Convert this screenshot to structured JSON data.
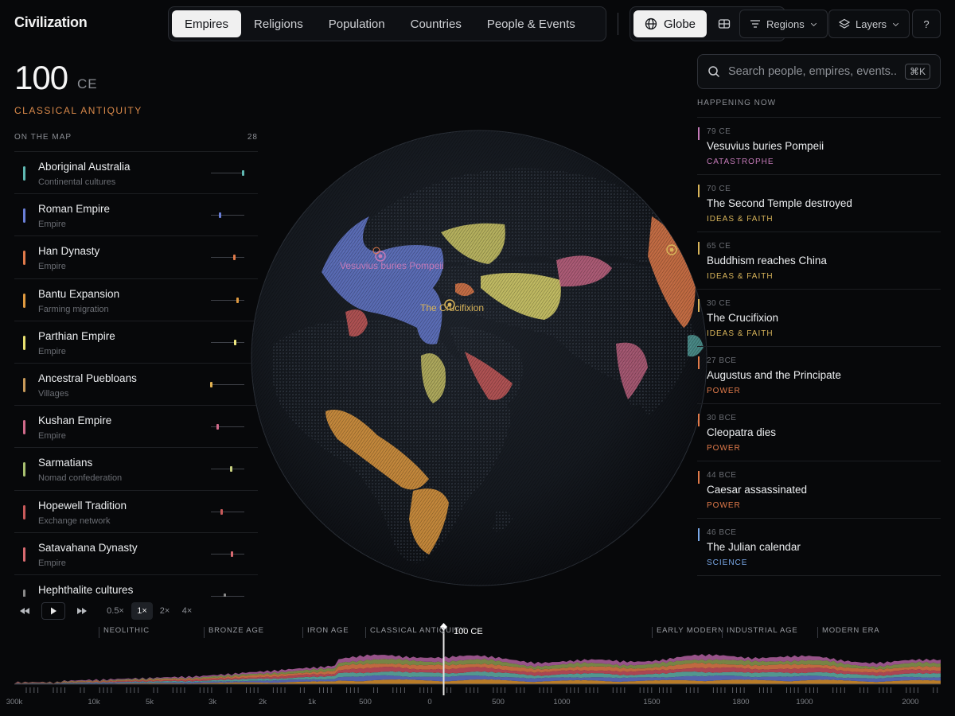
{
  "app": {
    "title": "Civilization"
  },
  "tabs": [
    {
      "label": "Empires",
      "active": true
    },
    {
      "label": "Religions",
      "active": false
    },
    {
      "label": "Population",
      "active": false
    },
    {
      "label": "Countries",
      "active": false
    },
    {
      "label": "People & Events",
      "active": false
    }
  ],
  "viewmode": {
    "globe_label": "Globe"
  },
  "header": {
    "regions_label": "Regions",
    "layers_label": "Layers",
    "help_label": "?"
  },
  "current": {
    "year": "100",
    "era_suffix": "CE",
    "epoch": "CLASSICAL ANTIQUITY"
  },
  "on_map": {
    "heading": "ON THE MAP",
    "count": "28",
    "items": [
      {
        "name": "Aboriginal Australia",
        "type": "Continental cultures",
        "color": "#5fb8b2",
        "tick": 0.95,
        "tick_color": "#5fb8b2"
      },
      {
        "name": "Roman Empire",
        "type": "Empire",
        "color": "#6a7fd8",
        "tick": 0.25,
        "tick_color": "#6a7fd8"
      },
      {
        "name": "Han Dynasty",
        "type": "Empire",
        "color": "#e07a4a",
        "tick": 0.7,
        "tick_color": "#e07a4a"
      },
      {
        "name": "Bantu Expansion",
        "type": "Farming migration",
        "color": "#e09a40",
        "tick": 0.78,
        "tick_color": "#e09a40"
      },
      {
        "name": "Parthian Empire",
        "type": "Empire",
        "color": "#e8e070",
        "tick": 0.72,
        "tick_color": "#f0e880"
      },
      {
        "name": "Ancestral Puebloans",
        "type": "Villages",
        "color": "#c89a5a",
        "tick": 0.0,
        "tick_color": "#e0b050"
      },
      {
        "name": "Kushan Empire",
        "type": "Empire",
        "color": "#d06a8a",
        "tick": 0.2,
        "tick_color": "#d06a8a"
      },
      {
        "name": "Sarmatians",
        "type": "Nomad confederation",
        "color": "#a8c070",
        "tick": 0.6,
        "tick_color": "#c8d080"
      },
      {
        "name": "Hopewell Tradition",
        "type": "Exchange network",
        "color": "#c85a5a",
        "tick": 0.32,
        "tick_color": "#c85a5a"
      },
      {
        "name": "Satavahana Dynasty",
        "type": "Empire",
        "color": "#d86a70",
        "tick": 0.62,
        "tick_color": "#d86a70"
      },
      {
        "name": "Hephthalite cultures",
        "type": "",
        "color": "#8a8a8a",
        "tick": 0.4,
        "tick_color": "#8a8a8a"
      }
    ]
  },
  "globe": {
    "labels": [
      {
        "text": "Vesuvius buries Pompeii",
        "color": "#c47ab8"
      },
      {
        "text": "The Crucifixion",
        "color": "#d8b45a"
      }
    ]
  },
  "search": {
    "placeholder": "Search people, empires, events...",
    "shortcut": "⌘K"
  },
  "happening_now": {
    "heading": "HAPPENING NOW",
    "events": [
      {
        "date": "79 CE",
        "title": "Vesuvius buries Pompeii",
        "category": "CATASTROPHE",
        "color": "#c47ab8"
      },
      {
        "date": "70 CE",
        "title": "The Second Temple destroyed",
        "category": "IDEAS & FAITH",
        "color": "#d8b45a"
      },
      {
        "date": "65 CE",
        "title": "Buddhism reaches China",
        "category": "IDEAS & FAITH",
        "color": "#d8b45a"
      },
      {
        "date": "30 CE",
        "title": "The Crucifixion",
        "category": "IDEAS & FAITH",
        "color": "#d8b45a"
      },
      {
        "date": "27 BCE",
        "title": "Augustus and the Principate",
        "category": "POWER",
        "color": "#e07a4a"
      },
      {
        "date": "30 BCE",
        "title": "Cleopatra dies",
        "category": "POWER",
        "color": "#e07a4a"
      },
      {
        "date": "44 BCE",
        "title": "Caesar assassinated",
        "category": "POWER",
        "color": "#e07a4a"
      },
      {
        "date": "46 BCE",
        "title": "The Julian calendar",
        "category": "SCIENCE",
        "color": "#7aa8e8"
      }
    ]
  },
  "playback": {
    "speeds": [
      "0.5×",
      "1×",
      "2×",
      "4×"
    ],
    "active_speed": "1×"
  },
  "timeline": {
    "current_label": "100 CE",
    "eras": [
      "NEOLITHIC",
      "BRONZE AGE",
      "IRON AGE",
      "CLASSICAL ANTIQUITY",
      "EARLY MODERN",
      "INDUSTRIAL AGE",
      "MODERN ERA"
    ],
    "axis_labels": [
      "300k",
      "10k",
      "5k",
      "3k",
      "2k",
      "1k",
      "500",
      "0",
      "500",
      "1000",
      "1500",
      "1800",
      "1900",
      "2000"
    ],
    "series_colors": [
      "#d8902e",
      "#6272c8",
      "#5fb0a8",
      "#c85060",
      "#e07a4a",
      "#8a9a50",
      "#b060a0"
    ]
  }
}
